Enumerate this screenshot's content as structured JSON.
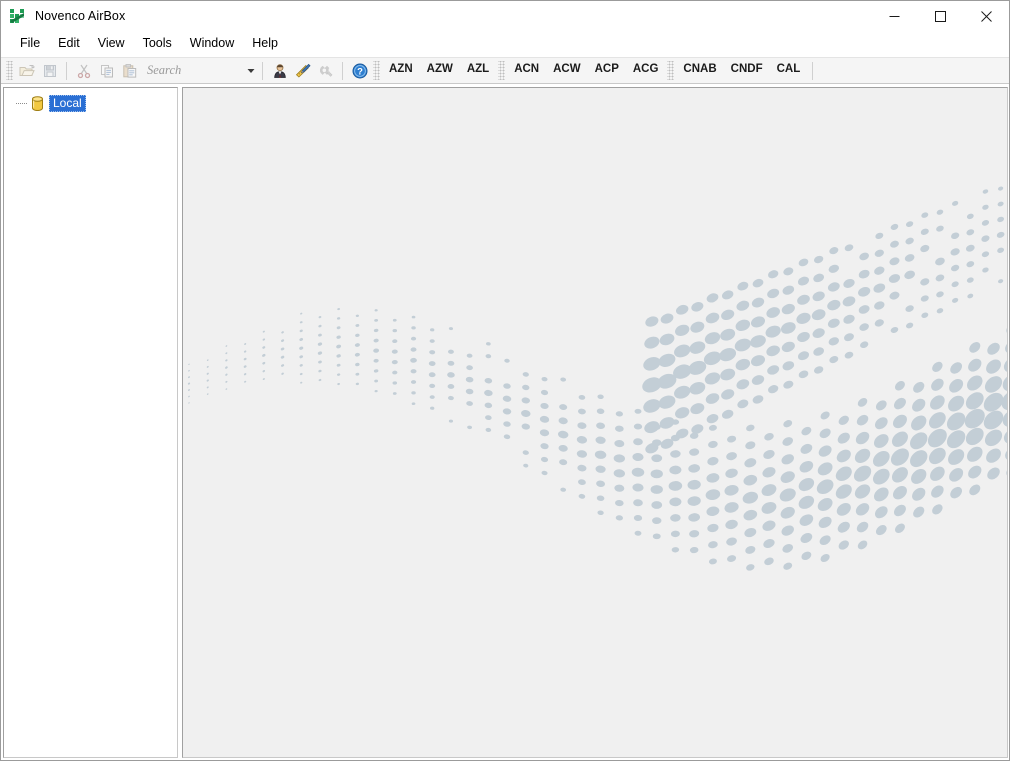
{
  "window": {
    "title": "Novenco AirBox",
    "app_icon": "novenco-airbox-logo-icon",
    "controls": {
      "minimize": "minimize-icon",
      "maximize": "maximize-icon",
      "close": "close-icon"
    }
  },
  "menubar": {
    "items": [
      {
        "label": "File"
      },
      {
        "label": "Edit"
      },
      {
        "label": "View"
      },
      {
        "label": "Tools"
      },
      {
        "label": "Window"
      },
      {
        "label": "Help"
      }
    ]
  },
  "toolbar": {
    "icon_buttons": [
      {
        "name": "open-icon",
        "tooltip": "Open",
        "enabled": false
      },
      {
        "name": "save-icon",
        "tooltip": "Save",
        "enabled": false
      },
      {
        "name": "cut-icon",
        "tooltip": "Cut",
        "enabled": false
      },
      {
        "name": "copy-icon",
        "tooltip": "Copy",
        "enabled": false
      },
      {
        "name": "paste-icon",
        "tooltip": "Paste",
        "enabled": false
      }
    ],
    "search": {
      "value": "",
      "placeholder": "Search",
      "dropdown_icon": "chevron-down-icon"
    },
    "action_icons": [
      {
        "name": "user-icon",
        "tooltip": "User",
        "enabled": true
      },
      {
        "name": "ruler-pencil-icon",
        "tooltip": "Design",
        "enabled": true
      },
      {
        "name": "settings-wrench-icon",
        "tooltip": "Settings",
        "enabled": false
      },
      {
        "name": "help-icon",
        "tooltip": "Help",
        "enabled": true
      }
    ],
    "groups": [
      {
        "name": "az-group",
        "buttons": [
          "AZN",
          "AZW",
          "AZL"
        ]
      },
      {
        "name": "ac-group",
        "buttons": [
          "ACN",
          "ACW",
          "ACP",
          "ACG"
        ]
      },
      {
        "name": "cn-group",
        "buttons": [
          "CNAB",
          "CNDF",
          "CAL"
        ]
      }
    ]
  },
  "sidebar": {
    "tree": [
      {
        "label": "Local",
        "icon": "database-cylinder-icon",
        "selected": true
      }
    ]
  },
  "content": {
    "watermark": "halftone-wave-graphic"
  },
  "colors": {
    "titlebar_bg": "#ffffff",
    "toolbar_bg": "#f5f5f5",
    "sidebar_bg": "#ffffff",
    "content_bg": "#f0f0f0",
    "selection_blue": "#2a6fd4",
    "watermark_dot": "#c3ced6",
    "window_border": "#9b9b9b",
    "brand_green": "#1f9d55"
  }
}
